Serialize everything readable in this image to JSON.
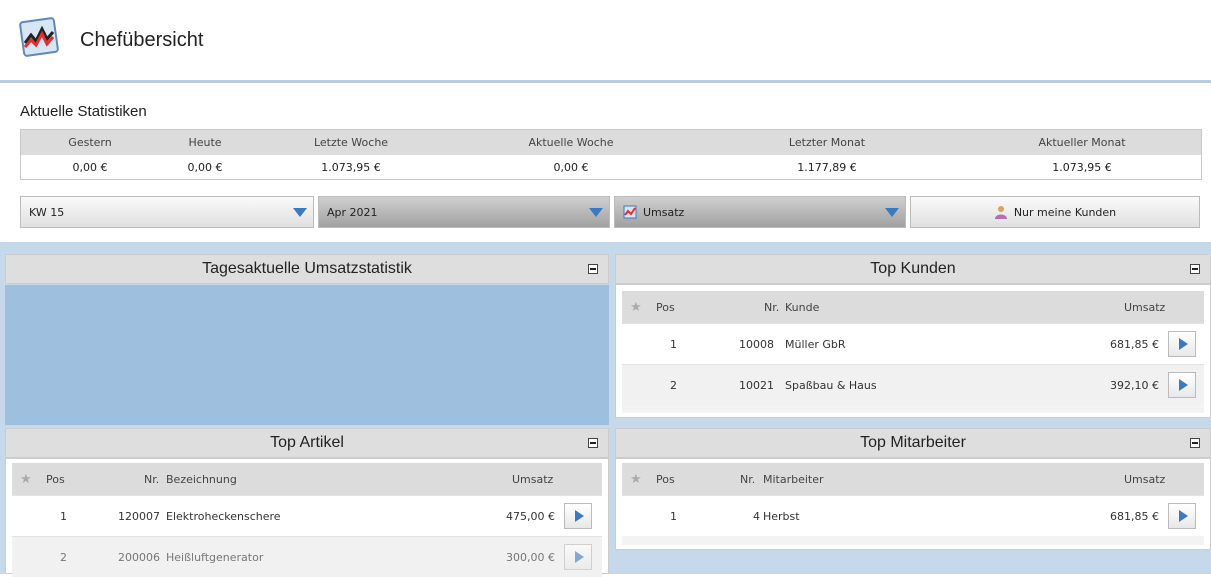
{
  "header": {
    "title": "Chefübersicht"
  },
  "stats": {
    "title": "Aktuelle Statistiken",
    "columns": [
      "Gestern",
      "Heute",
      "Letzte Woche",
      "Aktuelle Woche",
      "Letzter Monat",
      "Aktueller Monat"
    ],
    "values": [
      "0,00 €",
      "0,00 €",
      "1.073,95 €",
      "0,00 €",
      "1.177,89 €",
      "1.073,95 €"
    ]
  },
  "filters": {
    "week": "KW 15",
    "month": "Apr 2021",
    "metric": "Umsatz",
    "own_customers_label": "Nur meine Kunden"
  },
  "panels": {
    "tagesaktuell": {
      "title": "Tagesaktuelle Umsatzstatistik"
    },
    "top_kunden": {
      "title": "Top Kunden",
      "headers": {
        "pos": "Pos",
        "nr": "Nr.",
        "name": "Kunde",
        "umsatz": "Umsatz"
      },
      "rows": [
        {
          "pos": "1",
          "nr": "10008",
          "name": "Müller GbR",
          "umsatz": "681,85 €"
        },
        {
          "pos": "2",
          "nr": "10021",
          "name": "Spaßbau & Haus",
          "umsatz": "392,10 €"
        }
      ]
    },
    "top_artikel": {
      "title": "Top Artikel",
      "headers": {
        "pos": "Pos",
        "nr": "Nr.",
        "name": "Bezeichnung",
        "umsatz": "Umsatz"
      },
      "rows": [
        {
          "pos": "1",
          "nr": "120007",
          "name": "Elektroheckenschere",
          "umsatz": "475,00 €"
        },
        {
          "pos": "2",
          "nr": "200006",
          "name": "Heißluftgenerator",
          "umsatz": "300,00 €"
        }
      ]
    },
    "top_mitarbeiter": {
      "title": "Top Mitarbeiter",
      "headers": {
        "pos": "Pos",
        "nr": "Nr.",
        "name": "Mitarbeiter",
        "umsatz": "Umsatz"
      },
      "rows": [
        {
          "pos": "1",
          "nr": "4",
          "name": "Herbst",
          "umsatz": "681,85 €"
        }
      ]
    }
  },
  "icons": {
    "logo": "chart-logo-icon",
    "star": "star-icon",
    "play": "play-icon",
    "person": "person-icon",
    "chart_small": "chart-icon",
    "dropdown": "chevron-down-icon",
    "collapse": "collapse-icon"
  },
  "colors": {
    "accent_blue": "#3a7ac0",
    "panel_blue": "#9ebfdd",
    "background_blue": "#c6d9ea"
  }
}
